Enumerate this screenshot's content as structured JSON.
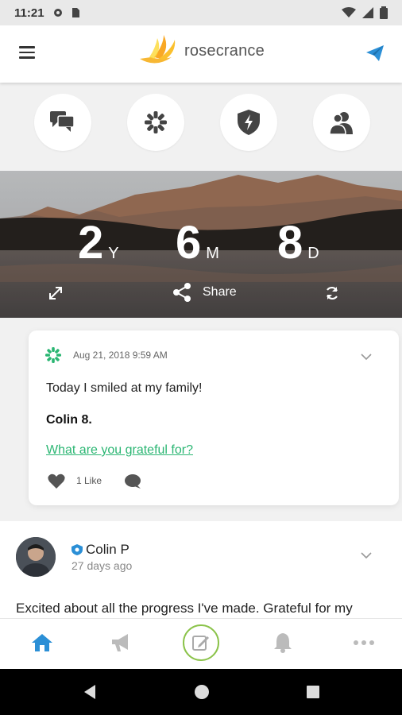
{
  "status_bar": {
    "time": "11:21"
  },
  "header": {
    "brand_name": "rosecrance",
    "menu_icon": "hamburger-icon",
    "action_icon": "paper-plane-icon"
  },
  "quick_actions": [
    {
      "icon": "chat-bubbles-icon"
    },
    {
      "icon": "flower-logo-icon"
    },
    {
      "icon": "shield-lightning-icon"
    },
    {
      "icon": "people-icon"
    }
  ],
  "sobriety_counter": {
    "years": "2",
    "years_unit": "Y",
    "months": "6",
    "months_unit": "M",
    "days": "8",
    "days_unit": "D",
    "share_label": "Share"
  },
  "featured_post": {
    "date": "Aug 21, 2018 9:59 AM",
    "message": "Today I smiled at my family!",
    "author": "Colin 8.",
    "prompt": "What are you grateful for?",
    "like_count": "1 Like"
  },
  "feed_post": {
    "author_name": "Colin P",
    "time_ago": "27 days ago",
    "body": "Excited about all the progress I've made. Grateful for my"
  },
  "colors": {
    "accent_blue": "#2b8fd6",
    "accent_green": "#2bb673",
    "compose_ring": "#8bc34a"
  }
}
